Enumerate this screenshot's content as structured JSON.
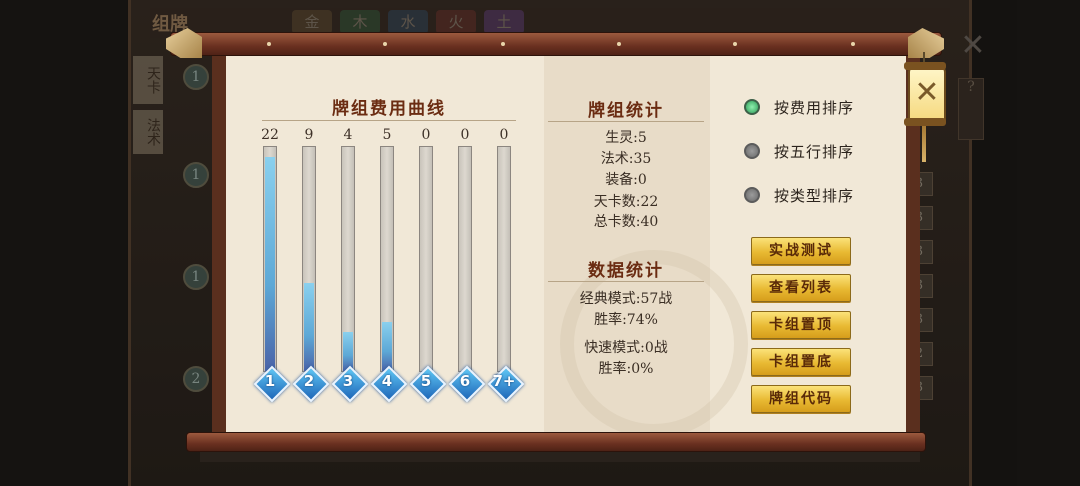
{
  "background": {
    "title": "组牌",
    "element_tabs": [
      "金",
      "木",
      "水",
      "火",
      "土"
    ],
    "left_tabs": [
      "天卡",
      "法术"
    ]
  },
  "cost_curve": {
    "title": "牌组费用曲线"
  },
  "chart_data": {
    "type": "bar",
    "title": "牌组费用曲线",
    "categories": [
      "1",
      "2",
      "3",
      "4",
      "5",
      "6",
      "7+"
    ],
    "values": [
      22,
      9,
      4,
      5,
      0,
      0,
      0
    ],
    "ylim": [
      0,
      22
    ]
  },
  "deck_stats": {
    "title": "牌组统计",
    "lines": [
      "生灵:5",
      "法术:35",
      "装备:0",
      "天卡数:22",
      "总卡数:40"
    ]
  },
  "data_stats": {
    "title": "数据统计",
    "lines": [
      "经典模式:57战",
      "胜率:74%",
      "快速模式:0战",
      "胜率:0%"
    ]
  },
  "sort_options": [
    {
      "label": "按费用排序",
      "selected": true
    },
    {
      "label": "按五行排序",
      "selected": false
    },
    {
      "label": "按类型排序",
      "selected": false
    }
  ],
  "buttons": [
    "实战测试",
    "查看列表",
    "卡组置顶",
    "卡组置底",
    "牌组代码"
  ],
  "close_label": "✕",
  "colors": {
    "accent_gold": "#e8b932",
    "title_red": "#6b2c12",
    "bar_blue": "#5da8d6"
  }
}
